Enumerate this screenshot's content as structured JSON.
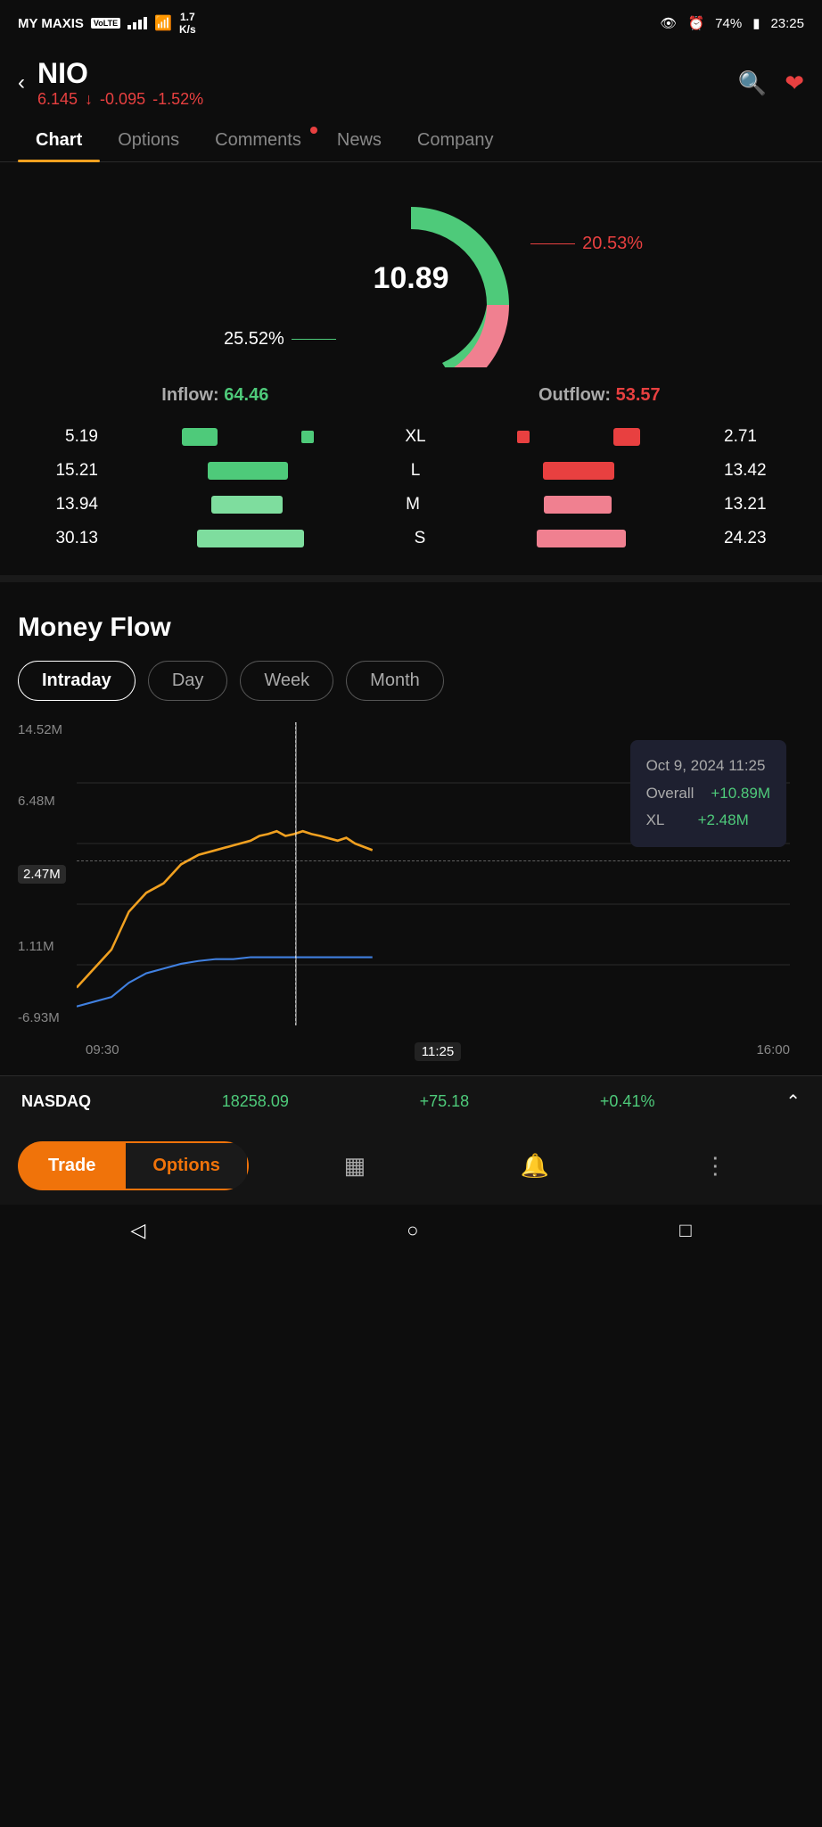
{
  "status": {
    "carrier": "MY MAXIS",
    "volte": "VoLTE",
    "speed": "1.7\nK/s",
    "battery": "74%",
    "time": "23:25"
  },
  "header": {
    "back": "‹",
    "symbol": "NIO",
    "price": "6.145",
    "arrow": "↓",
    "change": "-0.095",
    "pct": "-1.52%"
  },
  "tabs": [
    {
      "label": "Chart",
      "active": true,
      "dot": false
    },
    {
      "label": "Options",
      "active": false,
      "dot": false
    },
    {
      "label": "Comments",
      "active": false,
      "dot": true
    },
    {
      "label": "News",
      "active": false,
      "dot": false
    },
    {
      "label": "Company",
      "active": false,
      "dot": false
    }
  ],
  "donut": {
    "center_value": "10.89",
    "left_label": "25.52%",
    "right_label": "20.53%"
  },
  "flow_totals": {
    "inflow_label": "Inflow:",
    "inflow_value": "64.46",
    "outflow_label": "Outflow:",
    "outflow_value": "53.57"
  },
  "flow_rows": [
    {
      "left_val": "5.19",
      "label": "XL",
      "right_val": "2.71",
      "left_bar_w": 40,
      "right_bar_w": 30
    },
    {
      "left_val": "15.21",
      "label": "L",
      "right_val": "13.42",
      "left_bar_w": 90,
      "right_bar_w": 80
    },
    {
      "left_val": "13.94",
      "label": "M",
      "right_val": "13.21",
      "left_bar_w": 80,
      "right_bar_w": 75
    },
    {
      "left_val": "30.13",
      "label": "S",
      "right_val": "24.23",
      "left_bar_w": 120,
      "right_bar_w": 100
    }
  ],
  "money_flow": {
    "title": "Money Flow",
    "filters": [
      {
        "label": "Intraday",
        "active": true
      },
      {
        "label": "Day",
        "active": false
      },
      {
        "label": "Week",
        "active": false
      },
      {
        "label": "Month",
        "active": false
      }
    ]
  },
  "chart": {
    "y_labels": [
      "14.52M",
      "6.48M",
      "2.47M",
      "1.11M",
      "-6.93M"
    ],
    "x_labels": [
      "09:30",
      "11:25",
      "16:00"
    ],
    "tooltip": {
      "date": "Oct 9, 2024 11:25",
      "overall_label": "Overall",
      "overall_value": "+10.89M",
      "xl_label": "XL",
      "xl_value": "+2.48M"
    }
  },
  "nasdaq": {
    "name": "NASDAQ",
    "price": "18258.09",
    "change": "+75.18",
    "pct": "+0.41%"
  },
  "bottom_nav": {
    "trade": "Trade",
    "options": "Options"
  },
  "system_nav": {
    "back": "◁",
    "home": "○",
    "recent": "□"
  }
}
